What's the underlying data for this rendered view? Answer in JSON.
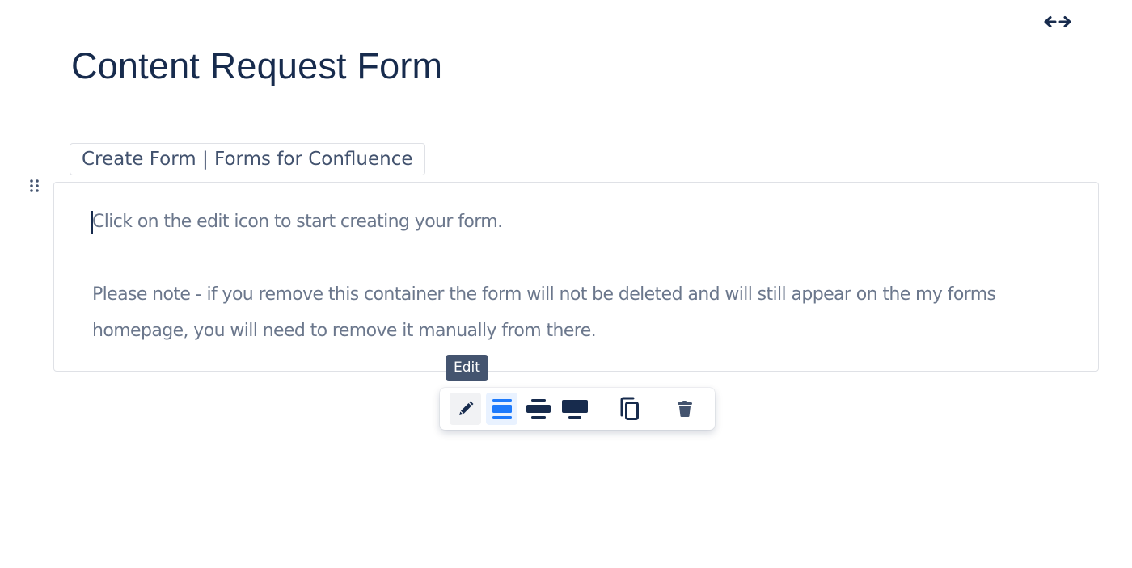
{
  "page": {
    "title": "Content Request Form"
  },
  "macro": {
    "label": "Create Form | Forms for Confluence",
    "instruction": "Click on the edit icon to start creating your form.",
    "note": "Please note - if you remove this container the form will not be deleted and will still appear on the my forms homepage, you will need to remove it manually from there."
  },
  "tooltip": {
    "text": "Edit"
  },
  "toolbar": {
    "buttons": [
      {
        "name": "edit",
        "icon": "pencil-icon",
        "state": "hover"
      },
      {
        "name": "layout-default",
        "icon": "layout-center-icon",
        "state": "selected"
      },
      {
        "name": "layout-wide",
        "icon": "layout-wide-icon",
        "state": "normal"
      },
      {
        "name": "layout-full-width",
        "icon": "layout-full-width-icon",
        "state": "normal"
      },
      {
        "name": "copy",
        "icon": "copy-icon",
        "state": "normal"
      },
      {
        "name": "delete",
        "icon": "trash-icon",
        "state": "normal"
      }
    ]
  },
  "colors": {
    "title": "#172b4d",
    "body_text": "#6b778c",
    "accent": "#1d7afc",
    "tooltip_bg": "#44546f",
    "icon_dark": "#172b4d"
  }
}
